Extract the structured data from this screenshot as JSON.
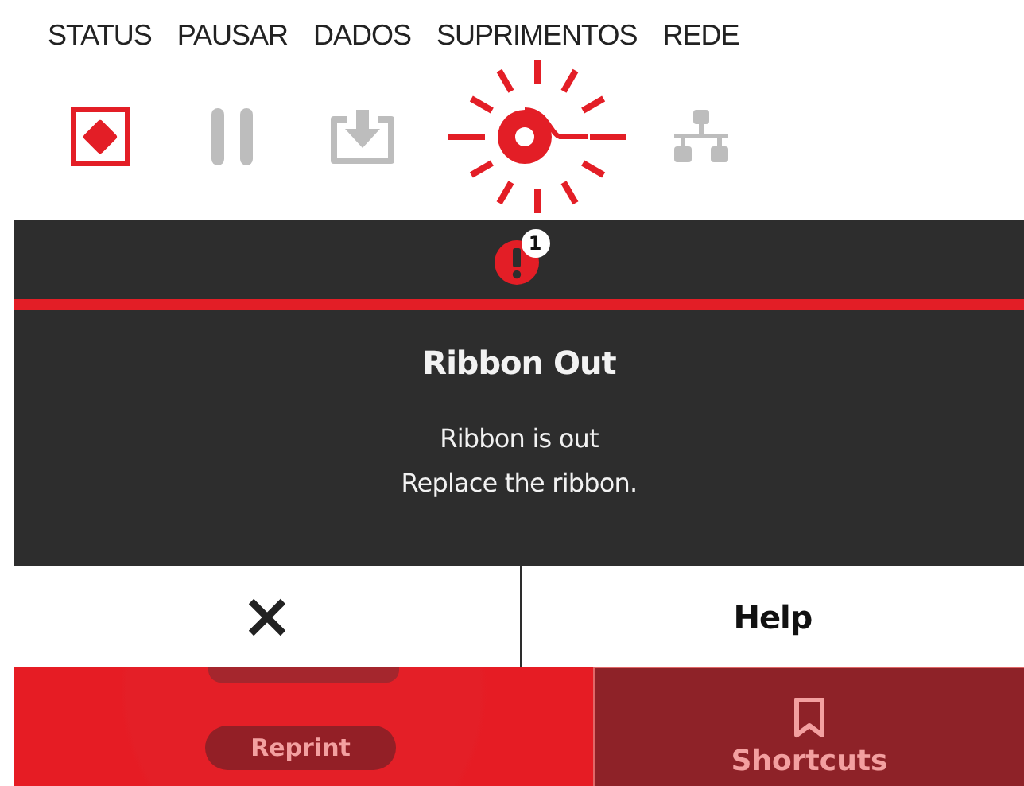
{
  "tabs": [
    {
      "label": "STATUS",
      "kind": "status",
      "alert": true
    },
    {
      "label": "PAUSAR",
      "kind": "pause",
      "alert": false
    },
    {
      "label": "DADOS",
      "kind": "data",
      "alert": false
    },
    {
      "label": "SUPRIMENTOS",
      "kind": "supplies",
      "alert": true
    },
    {
      "label": "REDE",
      "kind": "network",
      "alert": false
    }
  ],
  "alert": {
    "count": "1",
    "title": "Ribbon Out",
    "message": [
      "Ribbon is out",
      "Replace the ribbon."
    ]
  },
  "buttons": [
    {
      "kind": "close"
    },
    {
      "kind": "text",
      "label": "Help"
    }
  ],
  "home": [
    {
      "kind": "reprint",
      "label": "Reprint"
    },
    {
      "kind": "shortcuts",
      "label": "Shortcuts"
    }
  ]
}
